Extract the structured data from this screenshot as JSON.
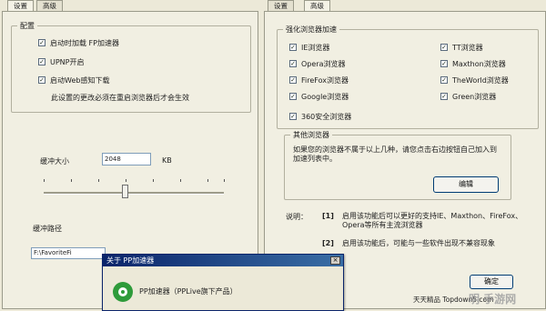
{
  "left": {
    "tabs": [
      "设置",
      "高级"
    ],
    "config_title": "配置",
    "options": [
      {
        "label": "启动时加载 FP加速器",
        "checked": true
      },
      {
        "label": "UPNP开启",
        "checked": true
      },
      {
        "label": "启动Web感知下载",
        "checked": true
      }
    ],
    "note": "此设置的更改必须在重启浏览器后才会生效",
    "buffer_label": "缓冲大小",
    "buffer_value": "2048",
    "buffer_unit": "KB",
    "buffer_level_percent": 45,
    "path_label": "缓冲路径",
    "path_value": "F:\\FavoriteFi"
  },
  "right": {
    "tabs": [
      "设置",
      "高级"
    ],
    "browser_group_title": "强化浏览器加速",
    "browsers_col1": [
      "IE浏览器",
      "Opera浏览器",
      "FireFox浏览器",
      "Google浏览器",
      "360安全浏览器"
    ],
    "browsers_col2": [
      "TT浏览器",
      "Maxthon浏览器",
      "TheWorld浏览器",
      "Green浏览器"
    ],
    "other_group_title": "其他浏览器",
    "other_text": "如果您的浏览器不属于以上几种，请您点击右边按钮自己加入到加速列表中。",
    "edit_button": "编辑",
    "explain_label": "说明：",
    "explain_items": [
      {
        "mark": "[1]",
        "text": "启用该功能后可以更好的支持IE、Maxthon、FireFox、Opera等所有主流浏览器"
      },
      {
        "mark": "[2]",
        "text": "启用该功能后，可能与一些软件出现不兼容现象"
      }
    ],
    "ok_button": "确定",
    "footer_text": "天天精品 Topdown5.com"
  },
  "dialog": {
    "title": "关于 PP加速器",
    "close_glyph": "×",
    "product": "PP加速器（PPLive旗下产品）"
  },
  "watermark": "明 手游网",
  "colors": {
    "window_bg": "#ece9d8",
    "titlebar": "#0a246a",
    "logo_green": "#2e9b3a"
  }
}
